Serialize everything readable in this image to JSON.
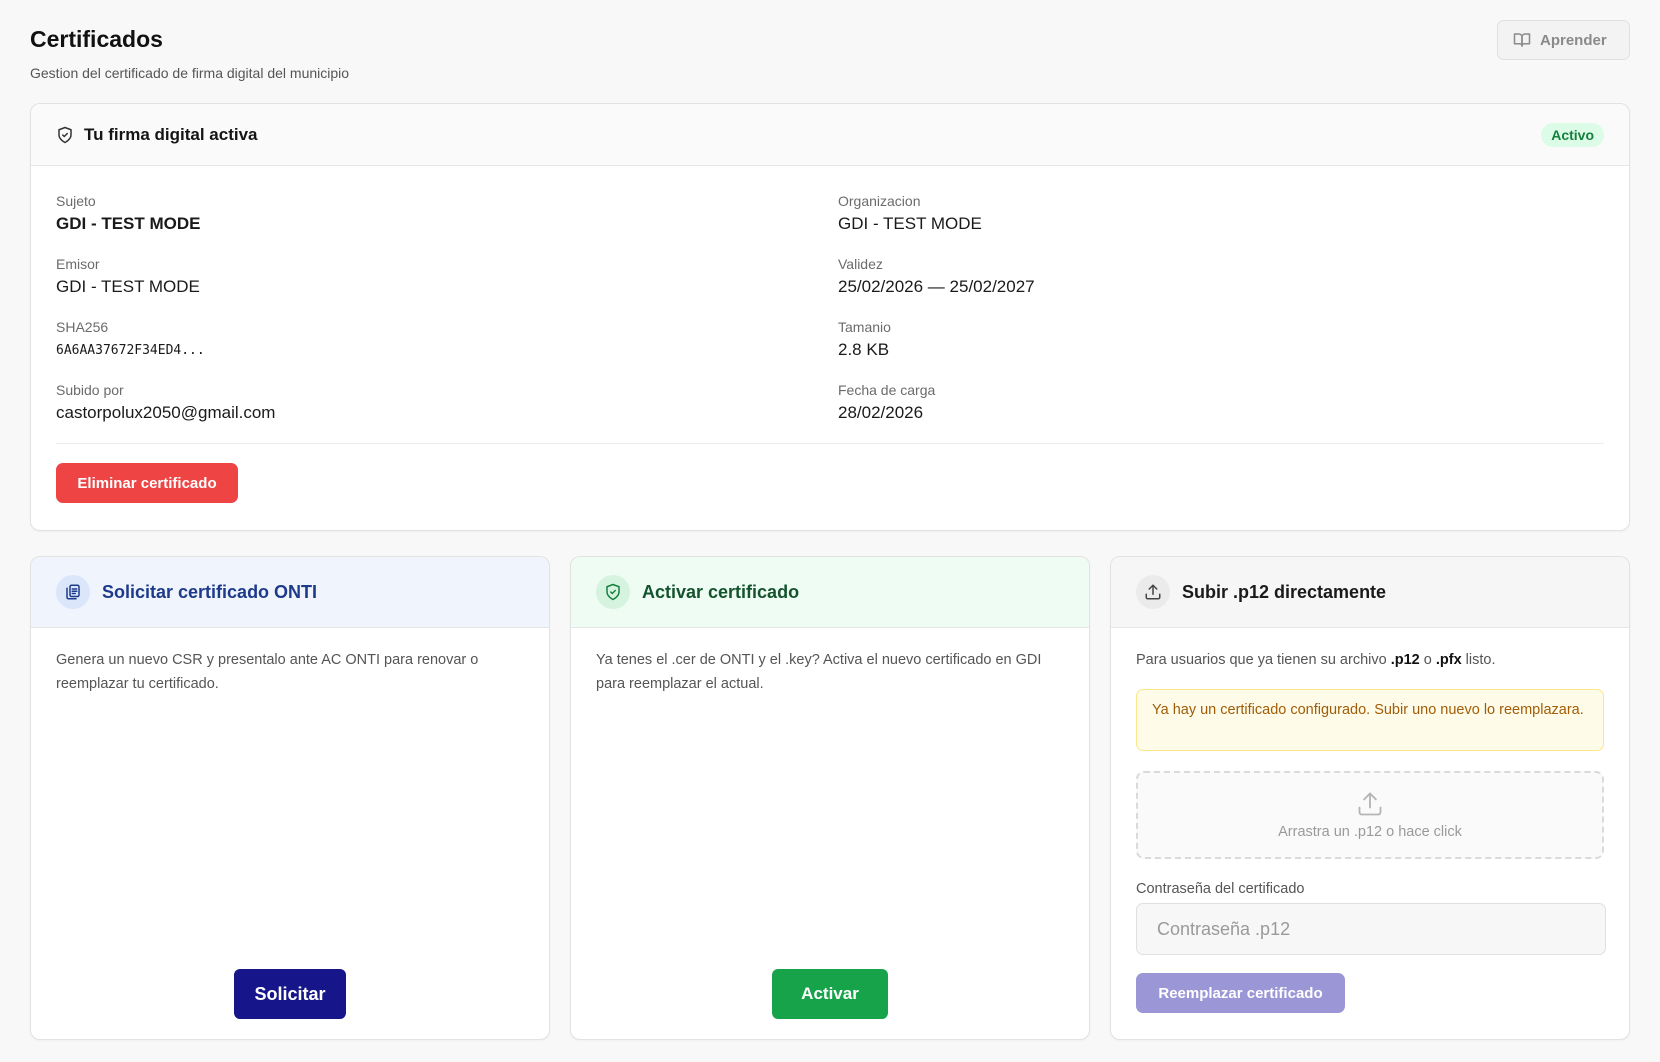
{
  "header": {
    "title": "Certificados",
    "subtitle": "Gestion del certificado de firma digital del municipio",
    "learn_label": "Aprender"
  },
  "active_signature": {
    "title": "Tu firma digital activa",
    "status": "Activo",
    "fields": {
      "subject_label": "Sujeto",
      "subject_value": "GDI - TEST MODE",
      "org_label": "Organizacion",
      "org_value": "GDI - TEST MODE",
      "issuer_label": "Emisor",
      "issuer_value": "GDI - TEST MODE",
      "validity_label": "Validez",
      "validity_value": "25/02/2026 — 25/02/2027",
      "sha_label": "SHA256",
      "sha_value": "6A6AA37672F34ED4...",
      "size_label": "Tamanio",
      "size_value": "2.8 KB",
      "uploaded_by_label": "Subido por",
      "uploaded_by_value": "castorpolux2050@gmail.com",
      "upload_date_label": "Fecha de carga",
      "upload_date_value": "28/02/2026"
    },
    "delete_label": "Eliminar certificado"
  },
  "request_card": {
    "title": "Solicitar certificado ONTI",
    "description": "Genera un nuevo CSR y presentalo ante AC ONTI para renovar o reemplazar tu certificado.",
    "button_label": "Solicitar"
  },
  "activate_card": {
    "title": "Activar certificado",
    "description": "Ya tenes el .cer de ONTI y el .key? Activa el nuevo certificado en GDI para reemplazar el actual.",
    "button_label": "Activar"
  },
  "upload_card": {
    "title": "Subir .p12 directamente",
    "desc_prefix": "Para usuarios que ya tienen su archivo ",
    "desc_ext1": ".p12",
    "desc_mid": " o ",
    "desc_ext2": ".pfx",
    "desc_suffix": " listo.",
    "warning": "Ya hay un certificado configurado. Subir uno nuevo lo reemplazara.",
    "dropzone_text": "Arrastra un .p12 o hace click",
    "password_label": "Contraseña del certificado",
    "password_placeholder": "Contraseña .p12",
    "replace_label": "Reemplazar certificado"
  },
  "colors": {
    "danger": "#ef4444",
    "navy": "#16168a",
    "success": "#16a34a",
    "badge_bg": "#dcfce7",
    "disabled_purple": "#9b96d6"
  }
}
